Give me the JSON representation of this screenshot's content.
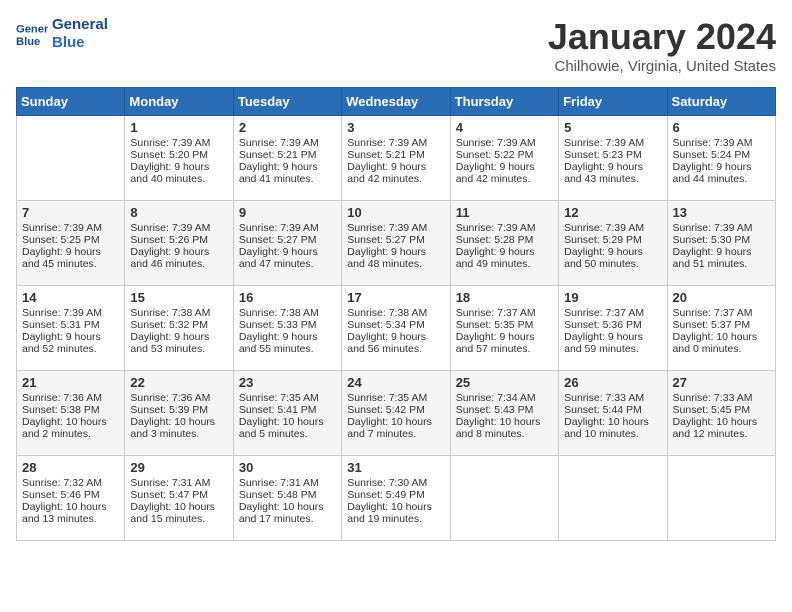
{
  "header": {
    "logo_line1": "General",
    "logo_line2": "Blue",
    "title": "January 2024",
    "subtitle": "Chilhowie, Virginia, United States"
  },
  "weekdays": [
    "Sunday",
    "Monday",
    "Tuesday",
    "Wednesday",
    "Thursday",
    "Friday",
    "Saturday"
  ],
  "weeks": [
    [
      {
        "day": "",
        "sunrise": "",
        "sunset": "",
        "daylight": ""
      },
      {
        "day": "1",
        "sunrise": "Sunrise: 7:39 AM",
        "sunset": "Sunset: 5:20 PM",
        "daylight": "Daylight: 9 hours and 40 minutes."
      },
      {
        "day": "2",
        "sunrise": "Sunrise: 7:39 AM",
        "sunset": "Sunset: 5:21 PM",
        "daylight": "Daylight: 9 hours and 41 minutes."
      },
      {
        "day": "3",
        "sunrise": "Sunrise: 7:39 AM",
        "sunset": "Sunset: 5:21 PM",
        "daylight": "Daylight: 9 hours and 42 minutes."
      },
      {
        "day": "4",
        "sunrise": "Sunrise: 7:39 AM",
        "sunset": "Sunset: 5:22 PM",
        "daylight": "Daylight: 9 hours and 42 minutes."
      },
      {
        "day": "5",
        "sunrise": "Sunrise: 7:39 AM",
        "sunset": "Sunset: 5:23 PM",
        "daylight": "Daylight: 9 hours and 43 minutes."
      },
      {
        "day": "6",
        "sunrise": "Sunrise: 7:39 AM",
        "sunset": "Sunset: 5:24 PM",
        "daylight": "Daylight: 9 hours and 44 minutes."
      }
    ],
    [
      {
        "day": "7",
        "sunrise": "Sunrise: 7:39 AM",
        "sunset": "Sunset: 5:25 PM",
        "daylight": "Daylight: 9 hours and 45 minutes."
      },
      {
        "day": "8",
        "sunrise": "Sunrise: 7:39 AM",
        "sunset": "Sunset: 5:26 PM",
        "daylight": "Daylight: 9 hours and 46 minutes."
      },
      {
        "day": "9",
        "sunrise": "Sunrise: 7:39 AM",
        "sunset": "Sunset: 5:27 PM",
        "daylight": "Daylight: 9 hours and 47 minutes."
      },
      {
        "day": "10",
        "sunrise": "Sunrise: 7:39 AM",
        "sunset": "Sunset: 5:27 PM",
        "daylight": "Daylight: 9 hours and 48 minutes."
      },
      {
        "day": "11",
        "sunrise": "Sunrise: 7:39 AM",
        "sunset": "Sunset: 5:28 PM",
        "daylight": "Daylight: 9 hours and 49 minutes."
      },
      {
        "day": "12",
        "sunrise": "Sunrise: 7:39 AM",
        "sunset": "Sunset: 5:29 PM",
        "daylight": "Daylight: 9 hours and 50 minutes."
      },
      {
        "day": "13",
        "sunrise": "Sunrise: 7:39 AM",
        "sunset": "Sunset: 5:30 PM",
        "daylight": "Daylight: 9 hours and 51 minutes."
      }
    ],
    [
      {
        "day": "14",
        "sunrise": "Sunrise: 7:39 AM",
        "sunset": "Sunset: 5:31 PM",
        "daylight": "Daylight: 9 hours and 52 minutes."
      },
      {
        "day": "15",
        "sunrise": "Sunrise: 7:38 AM",
        "sunset": "Sunset: 5:32 PM",
        "daylight": "Daylight: 9 hours and 53 minutes."
      },
      {
        "day": "16",
        "sunrise": "Sunrise: 7:38 AM",
        "sunset": "Sunset: 5:33 PM",
        "daylight": "Daylight: 9 hours and 55 minutes."
      },
      {
        "day": "17",
        "sunrise": "Sunrise: 7:38 AM",
        "sunset": "Sunset: 5:34 PM",
        "daylight": "Daylight: 9 hours and 56 minutes."
      },
      {
        "day": "18",
        "sunrise": "Sunrise: 7:37 AM",
        "sunset": "Sunset: 5:35 PM",
        "daylight": "Daylight: 9 hours and 57 minutes."
      },
      {
        "day": "19",
        "sunrise": "Sunrise: 7:37 AM",
        "sunset": "Sunset: 5:36 PM",
        "daylight": "Daylight: 9 hours and 59 minutes."
      },
      {
        "day": "20",
        "sunrise": "Sunrise: 7:37 AM",
        "sunset": "Sunset: 5:37 PM",
        "daylight": "Daylight: 10 hours and 0 minutes."
      }
    ],
    [
      {
        "day": "21",
        "sunrise": "Sunrise: 7:36 AM",
        "sunset": "Sunset: 5:38 PM",
        "daylight": "Daylight: 10 hours and 2 minutes."
      },
      {
        "day": "22",
        "sunrise": "Sunrise: 7:36 AM",
        "sunset": "Sunset: 5:39 PM",
        "daylight": "Daylight: 10 hours and 3 minutes."
      },
      {
        "day": "23",
        "sunrise": "Sunrise: 7:35 AM",
        "sunset": "Sunset: 5:41 PM",
        "daylight": "Daylight: 10 hours and 5 minutes."
      },
      {
        "day": "24",
        "sunrise": "Sunrise: 7:35 AM",
        "sunset": "Sunset: 5:42 PM",
        "daylight": "Daylight: 10 hours and 7 minutes."
      },
      {
        "day": "25",
        "sunrise": "Sunrise: 7:34 AM",
        "sunset": "Sunset: 5:43 PM",
        "daylight": "Daylight: 10 hours and 8 minutes."
      },
      {
        "day": "26",
        "sunrise": "Sunrise: 7:33 AM",
        "sunset": "Sunset: 5:44 PM",
        "daylight": "Daylight: 10 hours and 10 minutes."
      },
      {
        "day": "27",
        "sunrise": "Sunrise: 7:33 AM",
        "sunset": "Sunset: 5:45 PM",
        "daylight": "Daylight: 10 hours and 12 minutes."
      }
    ],
    [
      {
        "day": "28",
        "sunrise": "Sunrise: 7:32 AM",
        "sunset": "Sunset: 5:46 PM",
        "daylight": "Daylight: 10 hours and 13 minutes."
      },
      {
        "day": "29",
        "sunrise": "Sunrise: 7:31 AM",
        "sunset": "Sunset: 5:47 PM",
        "daylight": "Daylight: 10 hours and 15 minutes."
      },
      {
        "day": "30",
        "sunrise": "Sunrise: 7:31 AM",
        "sunset": "Sunset: 5:48 PM",
        "daylight": "Daylight: 10 hours and 17 minutes."
      },
      {
        "day": "31",
        "sunrise": "Sunrise: 7:30 AM",
        "sunset": "Sunset: 5:49 PM",
        "daylight": "Daylight: 10 hours and 19 minutes."
      },
      {
        "day": "",
        "sunrise": "",
        "sunset": "",
        "daylight": ""
      },
      {
        "day": "",
        "sunrise": "",
        "sunset": "",
        "daylight": ""
      },
      {
        "day": "",
        "sunrise": "",
        "sunset": "",
        "daylight": ""
      }
    ]
  ]
}
